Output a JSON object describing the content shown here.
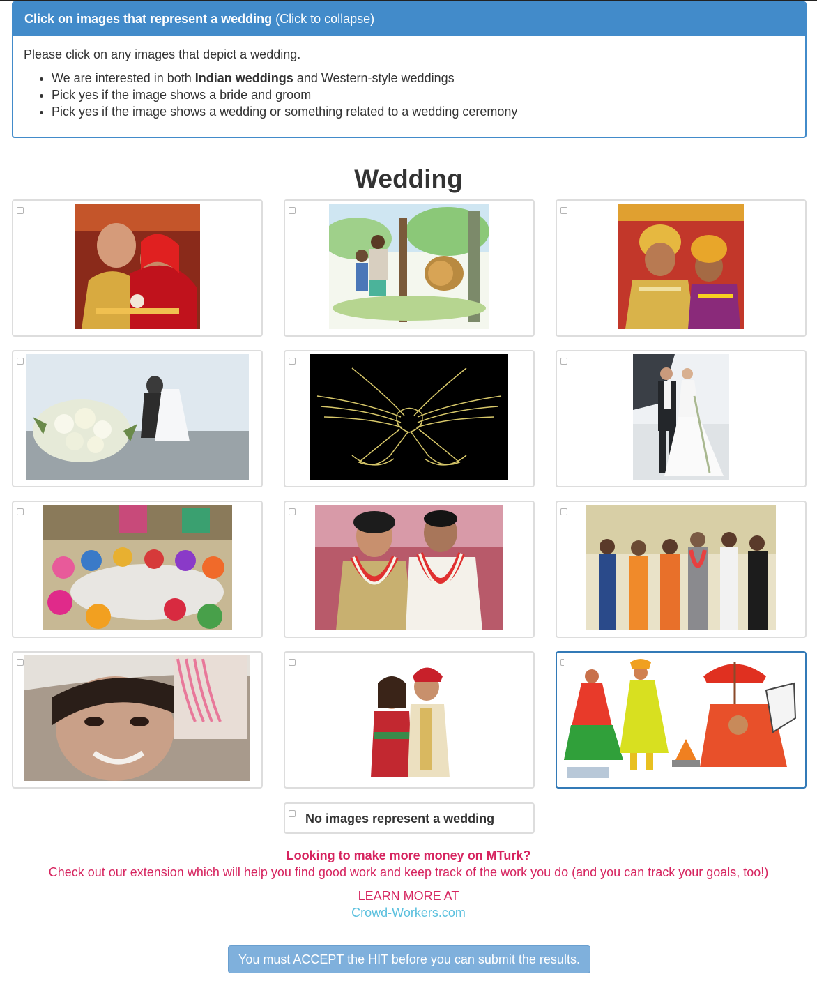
{
  "instructions": {
    "heading_bold": "Click on images that represent a wedding",
    "heading_rest": " (Click to collapse)",
    "intro": "Please click on any images that depict a wedding.",
    "bullets": [
      {
        "before": "We are interested in both ",
        "bold": "Indian weddings",
        "after": " and Western-style weddings"
      },
      {
        "before": "Pick yes if the image shows a bride and groom",
        "bold": "",
        "after": ""
      },
      {
        "before": "Pick yes if the image shows a wedding or something related to a wedding ceremony",
        "bold": "",
        "after": ""
      }
    ]
  },
  "title": "Wedding",
  "tiles": [
    {
      "image": "indian-couple-red-attire",
      "checked": false,
      "selected": false
    },
    {
      "image": "watercolor-men-and-lion",
      "checked": false,
      "selected": false
    },
    {
      "image": "children-in-traditional-dress",
      "checked": false,
      "selected": false
    },
    {
      "image": "bouquet-with-couple-background",
      "checked": false,
      "selected": false
    },
    {
      "image": "gold-knot-on-black",
      "checked": false,
      "selected": false
    },
    {
      "image": "western-bride-and-groom",
      "checked": false,
      "selected": false
    },
    {
      "image": "women-seated-at-ceremony",
      "checked": false,
      "selected": false
    },
    {
      "image": "couple-with-flower-garlands",
      "checked": false,
      "selected": false
    },
    {
      "image": "group-at-reception-stage",
      "checked": false,
      "selected": false
    },
    {
      "image": "smiling-woman-with-bangles",
      "checked": false,
      "selected": false
    },
    {
      "image": "couple-in-indian-wedding-attire",
      "checked": false,
      "selected": false
    },
    {
      "image": "illustrated-wedding-procession",
      "checked": false,
      "selected": true
    }
  ],
  "none_option": {
    "label": "No images represent a wedding",
    "checked": false
  },
  "promo": {
    "heading": "Looking to make more money on MTurk?",
    "subtext": "Check out our extension which will help you find good work and keep track of the work you do (and you can track your goals, too!)",
    "learn_more": "LEARN MORE AT",
    "link_text": "Crowd-Workers.com"
  },
  "submit_label": "You must ACCEPT the HIT before you can submit the results.",
  "colors": {
    "panel_blue": "#428bca",
    "promo_pink": "#d6245f",
    "link_cyan": "#5bc0de",
    "submit_blue": "#7fb0dc"
  }
}
